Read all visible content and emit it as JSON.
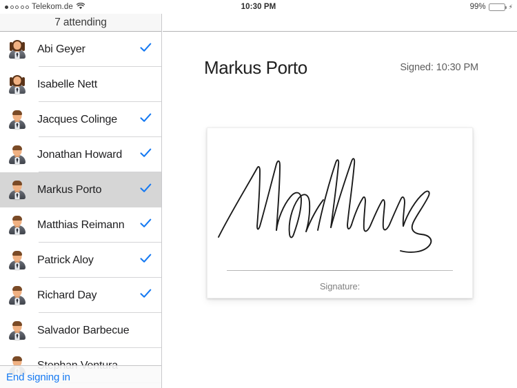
{
  "status_bar": {
    "carrier": "Telekom.de",
    "signal_dots": [
      true,
      false,
      false,
      false,
      false
    ],
    "wifi_icon": "wifi-icon",
    "time": "10:30 PM",
    "battery_percent": "99%",
    "battery_level": 99,
    "battery_color": "#4cd764",
    "charging": true,
    "charging_icon": "lightning-bolt-icon"
  },
  "sidebar": {
    "nav_title": "7 attending",
    "attendees": [
      {
        "name": "Abi Geyer",
        "gender": "female",
        "signed": true,
        "selected": false
      },
      {
        "name": "Isabelle Nett",
        "gender": "female",
        "signed": false,
        "selected": false
      },
      {
        "name": "Jacques Colinge",
        "gender": "male",
        "signed": true,
        "selected": false
      },
      {
        "name": "Jonathan Howard",
        "gender": "male",
        "signed": true,
        "selected": false
      },
      {
        "name": "Markus Porto",
        "gender": "male",
        "signed": true,
        "selected": true
      },
      {
        "name": "Matthias Reimann",
        "gender": "male",
        "signed": true,
        "selected": false
      },
      {
        "name": "Patrick Aloy",
        "gender": "male",
        "signed": true,
        "selected": false
      },
      {
        "name": "Richard Day",
        "gender": "male",
        "signed": true,
        "selected": false
      },
      {
        "name": "Salvador Barbecue",
        "gender": "male",
        "signed": false,
        "selected": false
      },
      {
        "name": "Stephan Ventura",
        "gender": "male",
        "signed": false,
        "selected": false
      }
    ],
    "toolbar": {
      "action_label": "End signing in",
      "action_color": "#1579f2"
    },
    "checkmark_color": "#1579f2",
    "selected_row_color": "#d6d6d6"
  },
  "detail": {
    "title": "Markus Porto",
    "signed_label": "Signed: 10:30 PM",
    "signature_caption": "Signature:",
    "signature_ink_color": "#1a1a1a"
  }
}
